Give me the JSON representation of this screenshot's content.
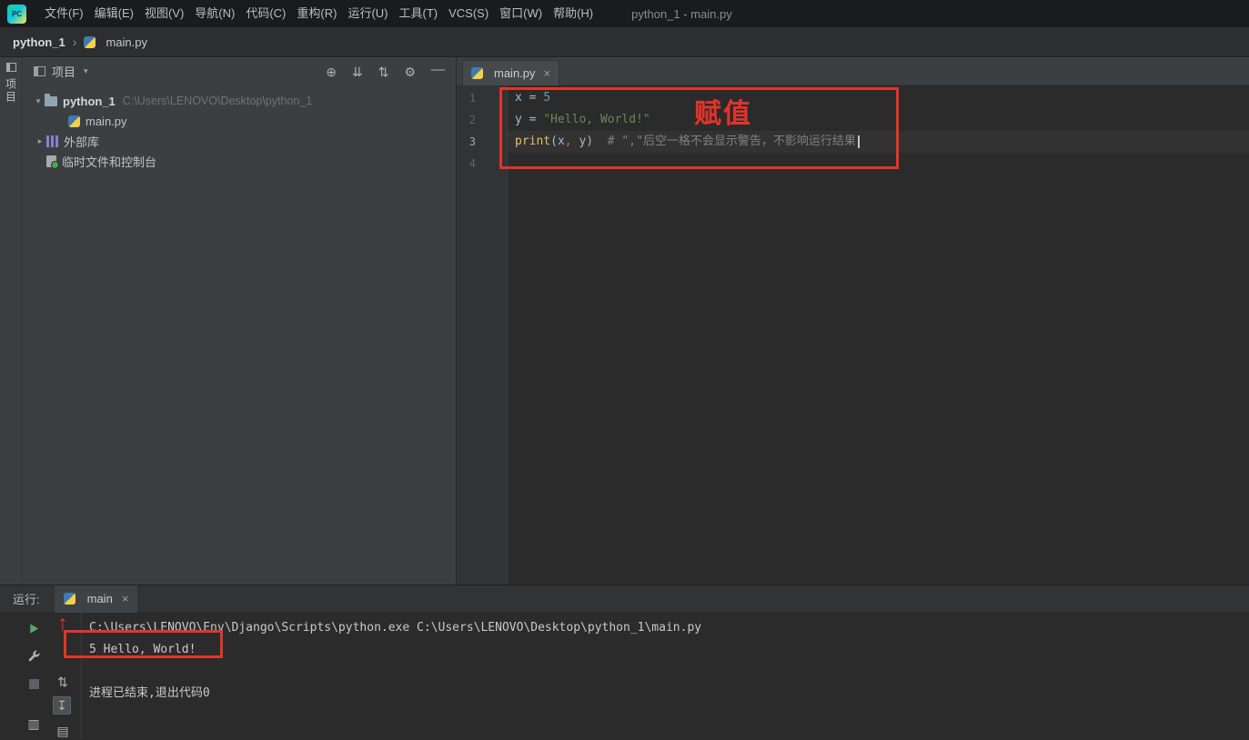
{
  "colors": {
    "annotation-red": "#e5332a",
    "run-green": "#59a869",
    "string-green": "#6a8759",
    "number-blue": "#6897bb",
    "comment-gray": "#808080",
    "func-yellow": "#e8bf6a",
    "comma-orange": "#cc7832",
    "plain-code": "#a9b7c6"
  },
  "titlebar": {
    "logo_text": "PC",
    "menu_items": [
      "文件(F)",
      "编辑(E)",
      "视图(V)",
      "导航(N)",
      "代码(C)",
      "重构(R)",
      "运行(U)",
      "工具(T)",
      "VCS(S)",
      "窗口(W)",
      "帮助(H)"
    ],
    "window_title": "python_1 - main.py"
  },
  "breadcrumb": {
    "project": "python_1",
    "separator": "›",
    "file": "main.py"
  },
  "left_stripe": {
    "label": "项目"
  },
  "project_panel": {
    "title": "项目",
    "dropdown_icon": "▾",
    "toolbar_icons": {
      "locate": "⊕",
      "collapse": "⇊",
      "expand": "⇅",
      "settings": "⚙",
      "hide": "—"
    },
    "tree": {
      "root": {
        "chevron": "▾",
        "label": "python_1",
        "path": "C:\\Users\\LENOVO\\Desktop\\python_1"
      },
      "main_file": {
        "label": "main.py"
      },
      "external_libraries": {
        "chevron": "▸",
        "label": "外部库"
      },
      "scratches": {
        "label": "临时文件和控制台"
      }
    }
  },
  "editor": {
    "tab": {
      "label": "main.py",
      "close": "×"
    },
    "gutter": [
      "1",
      "2",
      "3",
      "4"
    ],
    "code_lines": [
      {
        "tokens": [
          {
            "t": "x = "
          },
          {
            "t": "5"
          }
        ]
      },
      {
        "tokens": [
          {
            "t": "y = "
          },
          {
            "t": "\"Hello, World!\""
          }
        ]
      },
      {
        "tokens": [
          {
            "t": "print"
          },
          {
            "t": "(x"
          },
          {
            "t": ","
          },
          {
            "t": " y)"
          },
          {
            "t": "  # \",\"后空一格不会显示警告，不影响运行结果"
          }
        ]
      },
      {
        "tokens": []
      }
    ]
  },
  "run_panel": {
    "label": "运行:",
    "tab": {
      "label": "main",
      "close": "×"
    },
    "toolbar_icons": {
      "updown": "⇅",
      "scroll_end": "↧",
      "print": "▤",
      "layout": "▥"
    },
    "console_lines": [
      "C:\\Users\\LENOVO\\Env\\Django\\Scripts\\python.exe C:\\Users\\LENOVO\\Desktop\\python_1\\main.py",
      "5 Hello, World!",
      "",
      "进程已结束,退出代码0"
    ]
  },
  "annotations": {
    "label": "赋值",
    "arrow_up": "↑"
  }
}
